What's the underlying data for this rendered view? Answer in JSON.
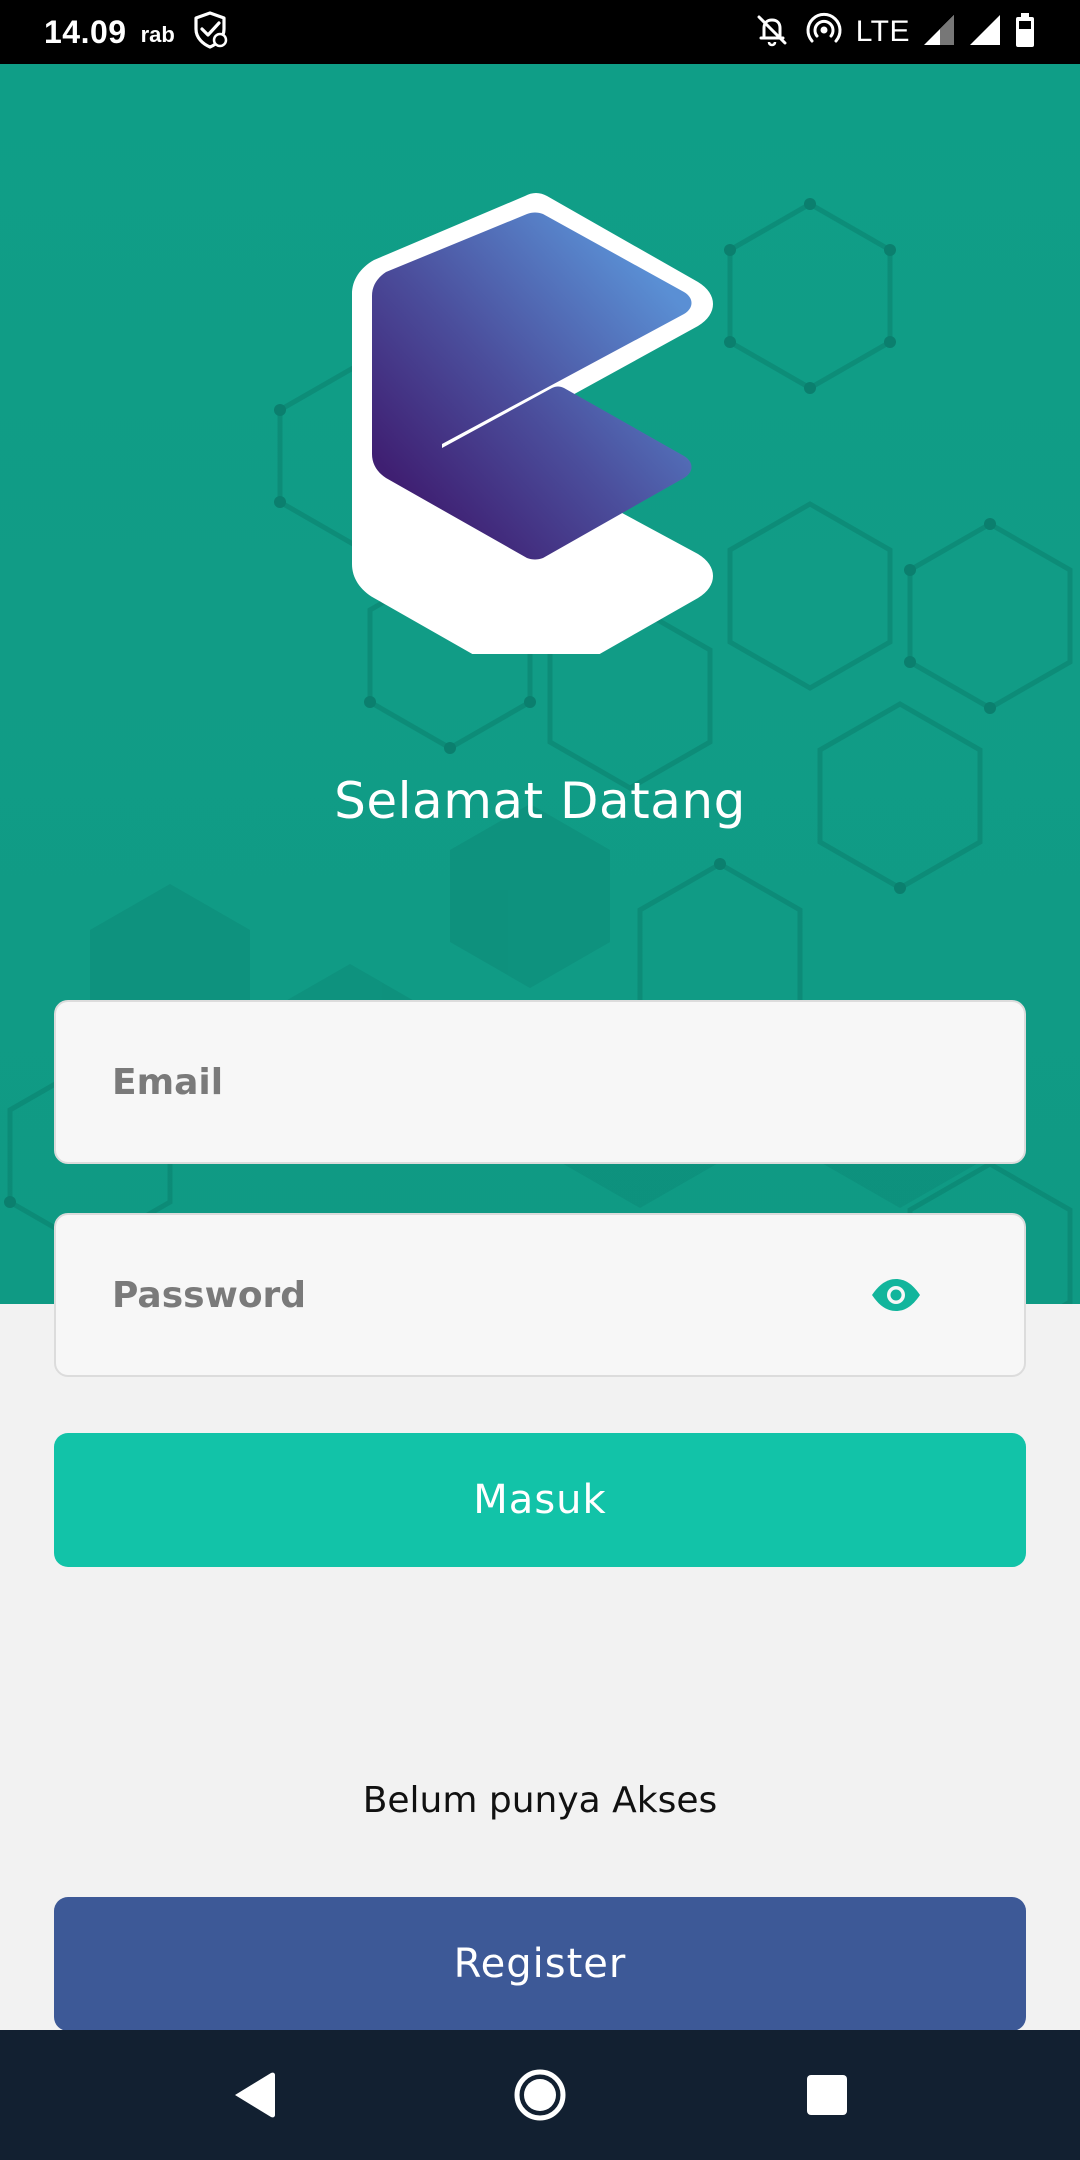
{
  "status_bar": {
    "time": "14.09",
    "day": "rab",
    "network": "LTE",
    "icons": [
      "shield-check-icon",
      "notifications-off-icon",
      "hotspot-icon",
      "signal-icon",
      "signal-icon",
      "battery-icon"
    ]
  },
  "header": {
    "logo": "hexagon-logo",
    "welcome": "Selamat Datang"
  },
  "form": {
    "email_placeholder": "Email",
    "email_value": "",
    "password_placeholder": "Password",
    "password_value": "",
    "password_toggle_icon": "eye-icon",
    "login_label": "Masuk"
  },
  "register_section": {
    "prompt": "Belum punya Akses",
    "register_label": "Register"
  },
  "nav": {
    "back_icon": "back-triangle-icon",
    "home_icon": "home-circle-icon",
    "recents_icon": "recents-square-icon"
  },
  "colors": {
    "header_bg": "#0f9e87",
    "login_button": "#12c3a8",
    "register_button": "#3d5997",
    "nav_bg": "#122031",
    "accent_eye": "#12b59c"
  }
}
